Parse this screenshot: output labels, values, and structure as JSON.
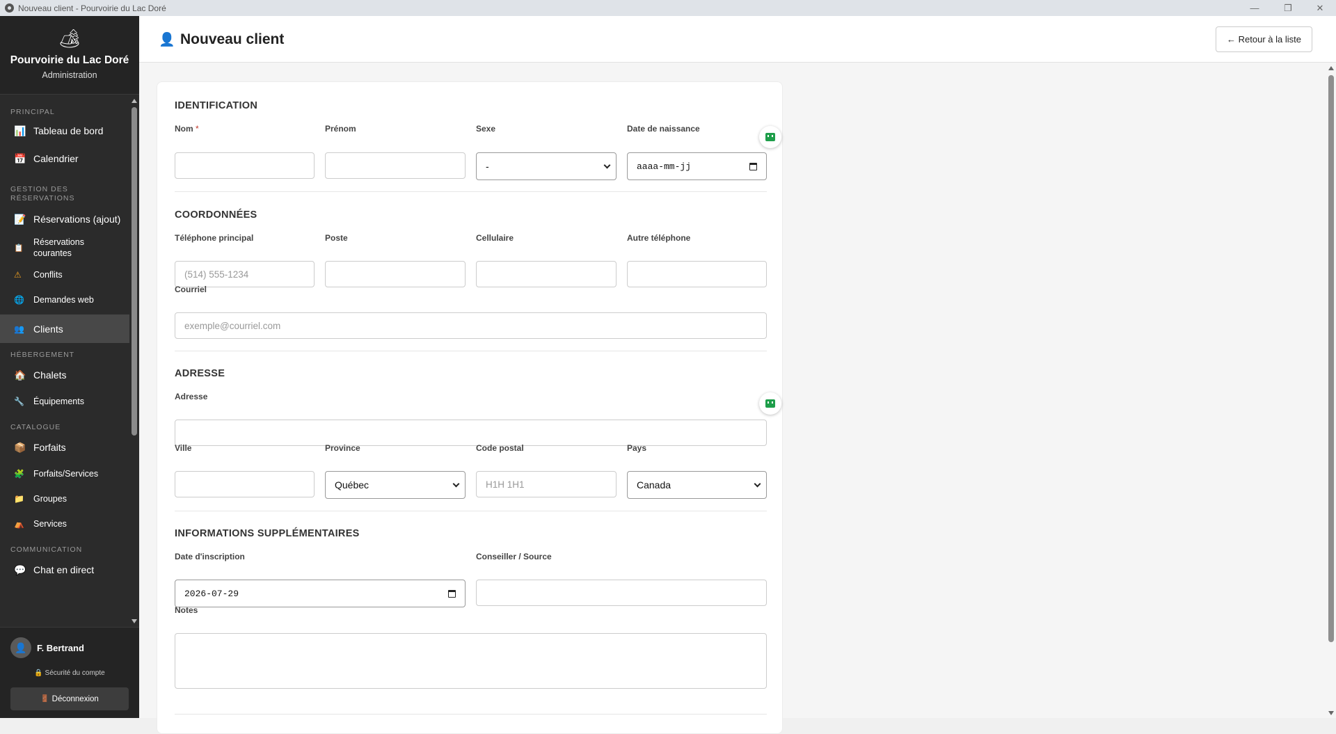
{
  "window": {
    "title": "Nouveau client - Pourvoirie du Lac Doré",
    "minimize": "—",
    "restore": "❐",
    "close": "✕"
  },
  "brand": {
    "logo_icon": "🏕",
    "name": "Pourvoirie du Lac Doré",
    "subtitle": "Administration"
  },
  "nav": {
    "sections": {
      "principal": "PRINCIPAL",
      "gestion": "GESTION DES RÉSERVATIONS",
      "hebergement": "HÉBERGEMENT",
      "catalogue": "CATALOGUE",
      "communication": "COMMUNICATION"
    },
    "items": {
      "tableau": {
        "icon": "📊",
        "label": "Tableau de bord"
      },
      "calendrier": {
        "icon": "📅",
        "label": "Calendrier"
      },
      "reservations_ajout": {
        "icon": "📝",
        "label": "Réservations (ajout)"
      },
      "reservations_courantes": {
        "icon": "📋",
        "label": "Réservations courantes"
      },
      "conflits": {
        "icon": "⚠",
        "label": "Conflits"
      },
      "demandes_web": {
        "icon": "🌐",
        "label": "Demandes web"
      },
      "clients": {
        "icon": "👥",
        "label": "Clients"
      },
      "chalets": {
        "icon": "🏠",
        "label": "Chalets"
      },
      "equipements": {
        "icon": "🔧",
        "label": "Équipements"
      },
      "forfaits": {
        "icon": "📦",
        "label": "Forfaits"
      },
      "forfaits_services": {
        "icon": "🧩",
        "label": "Forfaits/Services"
      },
      "groupes": {
        "icon": "📁",
        "label": "Groupes"
      },
      "services": {
        "icon": "⛺",
        "label": "Services"
      },
      "chat": {
        "icon": "💬",
        "label": "Chat en direct"
      }
    }
  },
  "user": {
    "avatar_icon": "👤",
    "name": "F. Bertrand",
    "security_icon": "🔒",
    "security": "Sécurité du compte",
    "logout_icon": "🚪",
    "logout": "Déconnexion"
  },
  "header": {
    "icon": "👤",
    "title": "Nouveau client",
    "back_button": "← Retour à la liste"
  },
  "form": {
    "identification": {
      "title": "IDENTIFICATION",
      "nom_label": "Nom",
      "required_mark": "*",
      "prenom_label": "Prénom",
      "sexe_label": "Sexe",
      "sexe_value": "-",
      "naissance_label": "Date de naissance",
      "naissance_placeholder": "aaaa-mm-jj"
    },
    "coordonnees": {
      "title": "COORDONNÉES",
      "tel_label": "Téléphone principal",
      "tel_placeholder": "(514) 555-1234",
      "poste_label": "Poste",
      "cell_label": "Cellulaire",
      "autre_label": "Autre téléphone",
      "courriel_label": "Courriel",
      "courriel_placeholder": "exemple@courriel.com"
    },
    "adresse": {
      "title": "ADRESSE",
      "adresse_label": "Adresse",
      "ville_label": "Ville",
      "province_label": "Province",
      "province_value": "Québec",
      "postal_label": "Code postal",
      "postal_placeholder": "H1H 1H1",
      "pays_label": "Pays",
      "pays_value": "Canada"
    },
    "supplementaires": {
      "title": "INFORMATIONS SUPPLÉMENTAIRES",
      "inscription_label": "Date d'inscription",
      "inscription_value": "2026-07-29",
      "conseiller_label": "Conseiller / Source",
      "notes_label": "Notes"
    }
  },
  "colors": {
    "sidebar_bg": "#2b2b2b",
    "active_item": "#484848",
    "accent_icon": "#4b2a82",
    "required": "#c0392b",
    "assistant": "#1e9e4a"
  }
}
